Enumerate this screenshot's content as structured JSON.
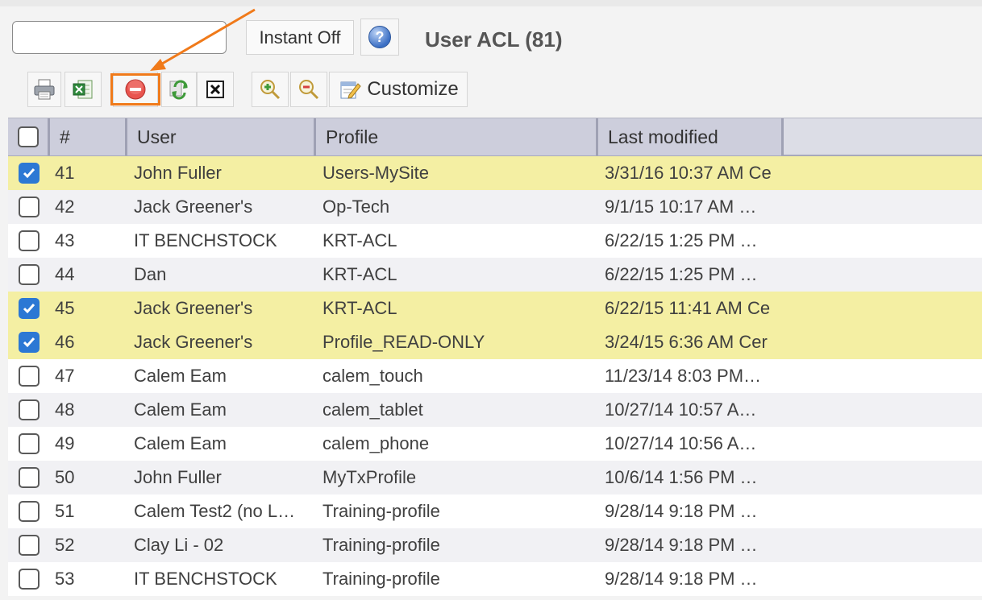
{
  "search": {
    "value": "",
    "placeholder": ""
  },
  "instant_toggle": {
    "label": "Instant Off"
  },
  "help": {
    "glyph": "?"
  },
  "title": "User ACL (81)",
  "toolbar": {
    "items": [
      {
        "name": "print-button",
        "icon": "printer-icon"
      },
      {
        "name": "export-excel-button",
        "icon": "excel-icon"
      },
      {
        "name": "delete-button",
        "icon": "delete-icon"
      },
      {
        "name": "refresh-button",
        "icon": "refresh-icon"
      },
      {
        "name": "clear-button",
        "icon": "close-box-icon"
      },
      {
        "name": "zoom-in-button",
        "icon": "zoom-in-icon"
      },
      {
        "name": "zoom-out-button",
        "icon": "zoom-out-icon"
      }
    ],
    "customize_label": "Customize"
  },
  "table": {
    "columns": [
      "#",
      "User",
      "Profile",
      "Last modified"
    ],
    "rows": [
      {
        "num": "41",
        "user": "John Fuller",
        "profile": "Users-MySite",
        "modified": "3/31/16 10:37 AM Ce",
        "checked": true
      },
      {
        "num": "42",
        "user": "Jack Greener's",
        "profile": "Op-Tech",
        "modified": "9/1/15 10:17 AM …",
        "checked": false
      },
      {
        "num": "43",
        "user": "IT BENCHSTOCK",
        "profile": "KRT-ACL",
        "modified": "6/22/15 1:25 PM …",
        "checked": false
      },
      {
        "num": "44",
        "user": "Dan",
        "profile": "KRT-ACL",
        "modified": "6/22/15 1:25 PM …",
        "checked": false
      },
      {
        "num": "45",
        "user": "Jack Greener's",
        "profile": "KRT-ACL",
        "modified": "6/22/15 11:41 AM Ce",
        "checked": true
      },
      {
        "num": "46",
        "user": "Jack Greener's",
        "profile": "Profile_READ-ONLY",
        "modified": "3/24/15 6:36 AM Cer",
        "checked": true
      },
      {
        "num": "47",
        "user": "Calem Eam",
        "profile": "calem_touch",
        "modified": "11/23/14 8:03 PM…",
        "checked": false
      },
      {
        "num": "48",
        "user": "Calem Eam",
        "profile": "calem_tablet",
        "modified": "10/27/14 10:57 A…",
        "checked": false
      },
      {
        "num": "49",
        "user": "Calem Eam",
        "profile": "calem_phone",
        "modified": "10/27/14 10:56 A…",
        "checked": false
      },
      {
        "num": "50",
        "user": "John Fuller",
        "profile": "MyTxProfile",
        "modified": "10/6/14 1:56 PM …",
        "checked": false
      },
      {
        "num": "51",
        "user": "Calem Test2 (no L…",
        "profile": "Training-profile",
        "modified": "9/28/14 9:18 PM …",
        "checked": false
      },
      {
        "num": "52",
        "user": "Clay Li - 02",
        "profile": "Training-profile",
        "modified": "9/28/14 9:18 PM …",
        "checked": false
      },
      {
        "num": "53",
        "user": "IT BENCHSTOCK",
        "profile": "Training-profile",
        "modified": "9/28/14 9:18 PM …",
        "checked": false
      }
    ]
  },
  "colors": {
    "selected_row": "#f4efa3",
    "accent_highlight": "#f07a1a",
    "checkbox_checked": "#2c78d4"
  }
}
